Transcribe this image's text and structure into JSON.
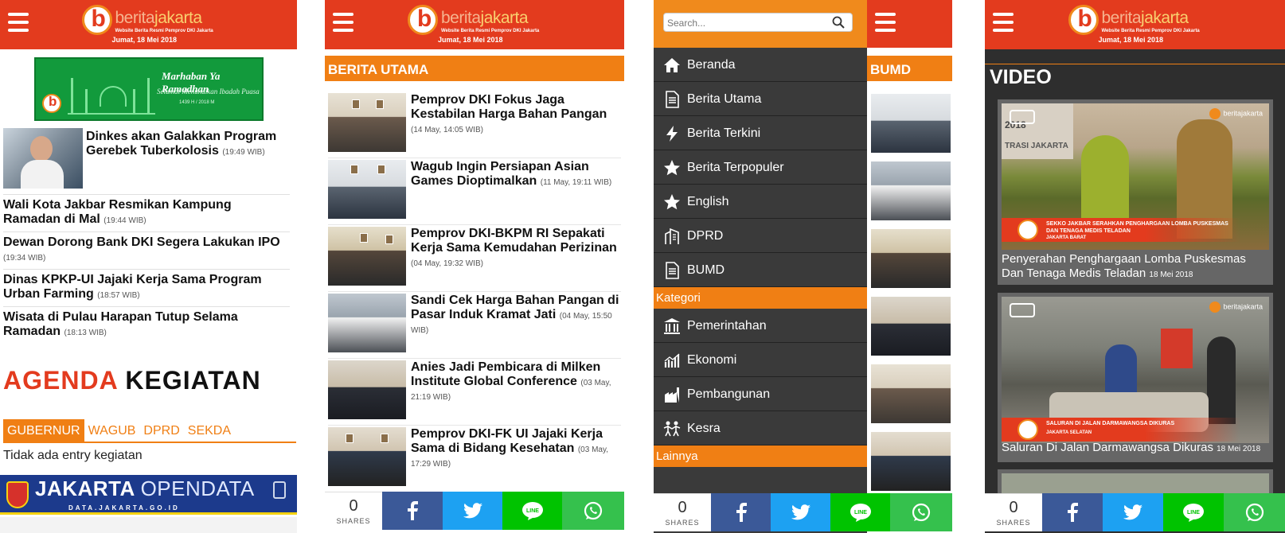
{
  "header": {
    "logo_part1": "berita",
    "logo_part2": "jakarta",
    "tagline": "Website Berita Resmi Pemprov DKI Jakarta",
    "date": "Jumat, 18 Mei 2018"
  },
  "panel1": {
    "banner": {
      "title": "Marhaban Ya Ramadhan",
      "subtitle": "Selamat Menunaikan Ibadah Puasa",
      "year": "1439 H / 2018 M"
    },
    "top_story": {
      "title": "Dinkes akan Galakkan Program Gerebek Tuberkolosis",
      "time": "(19:49 WIB)"
    },
    "stories": [
      {
        "title": "Wali Kota Jakbar Resmikan Kampung Ramadan di Mal",
        "time": "(19:44 WIB)"
      },
      {
        "title": "Dewan Dorong Bank DKI Segera Lakukan IPO",
        "time": "(19:34 WIB)"
      },
      {
        "title": "Dinas KPKP-UI Jajaki Kerja Sama Program Urban Farming",
        "time": "(18:57 WIB)"
      },
      {
        "title": "Wisata di Pulau Harapan Tutup Selama Ramadan",
        "time": "(18:13 WIB)"
      }
    ],
    "agenda_word1": "AGENDA",
    "agenda_word2": "KEGIATAN",
    "agenda_tabs": [
      "GUBERNUR",
      "WAGUB",
      "DPRD",
      "SEKDA"
    ],
    "agenda_empty": "Tidak ada entry kegiatan",
    "opendata": {
      "title_bold": "JAKARTA",
      "title_light": "OPENDATA",
      "url": "DATA.JAKARTA.GO.ID"
    }
  },
  "panel2": {
    "section": "BERITA UTAMA",
    "stories": [
      {
        "title": "Pemprov DKI Fokus Jaga Kestabilan Harga Bahan Pangan",
        "time": "(14 May, 14:05 WIB)"
      },
      {
        "title": "Wagub Ingin Persiapan Asian Games Dioptimalkan",
        "time": "(11 May, 19:11 WIB)"
      },
      {
        "title": "Pemprov DKI-BKPM RI Sepakati Kerja Sama Kemudahan Perizinan",
        "time": "(04 May, 19:32 WIB)"
      },
      {
        "title": "Sandi Cek Harga Bahan Pangan di Pasar Induk Kramat Jati",
        "time": "(04 May, 15:50 WIB)"
      },
      {
        "title": "Anies Jadi Pembicara di Milken Institute Global Conference",
        "time": "(03 May, 21:19 WIB)"
      },
      {
        "title": "Pemprov DKI-FK UI Jajaki Kerja Sama di Bidang Kesehatan",
        "time": "(03 May, 17:29 WIB)"
      }
    ]
  },
  "share": {
    "count": "0",
    "label": "SHARES"
  },
  "panel3": {
    "search_placeholder": "Search...",
    "menu": [
      "Beranda",
      "Berita Utama",
      "Berita Terkini",
      "Berita Terpopuler",
      "English",
      "DPRD",
      "BUMD"
    ],
    "category_header": "Kategori",
    "categories": [
      "Pemerintahan",
      "Ekonomi",
      "Pembangunan",
      "Kesra"
    ],
    "other_header": "Lainnya",
    "side_section": "BUMD"
  },
  "panel4": {
    "section": "VIDEO",
    "videos": [
      {
        "caption": "Penyerahan Penghargaan Lomba Puskesmas Dan Tenaga Medis Teladan",
        "date": "18 Mei 2018",
        "banner_line1": "SEKKO JAKBAR SERAHKAN PENGHARGAAN LOMBA PUSKESMAS",
        "banner_line2": "DAN TENAGA MEDIS TELADAN",
        "banner_place": "JAKARTA BARAT",
        "wall_text1": "2018",
        "wall_text2": "TRASI JAKARTA"
      },
      {
        "caption": "Saluran Di Jalan Darmawangsa Dikuras",
        "date": "18 Mei 2018",
        "banner_line1": "SALURAN DI JALAN DARMAWANGSA DIKURAS",
        "banner_place": "JAKARTA SELATAN"
      }
    ]
  },
  "colors": {
    "red": "#e33b1e",
    "orange": "#f07f14",
    "dark": "#3a3a3a"
  }
}
